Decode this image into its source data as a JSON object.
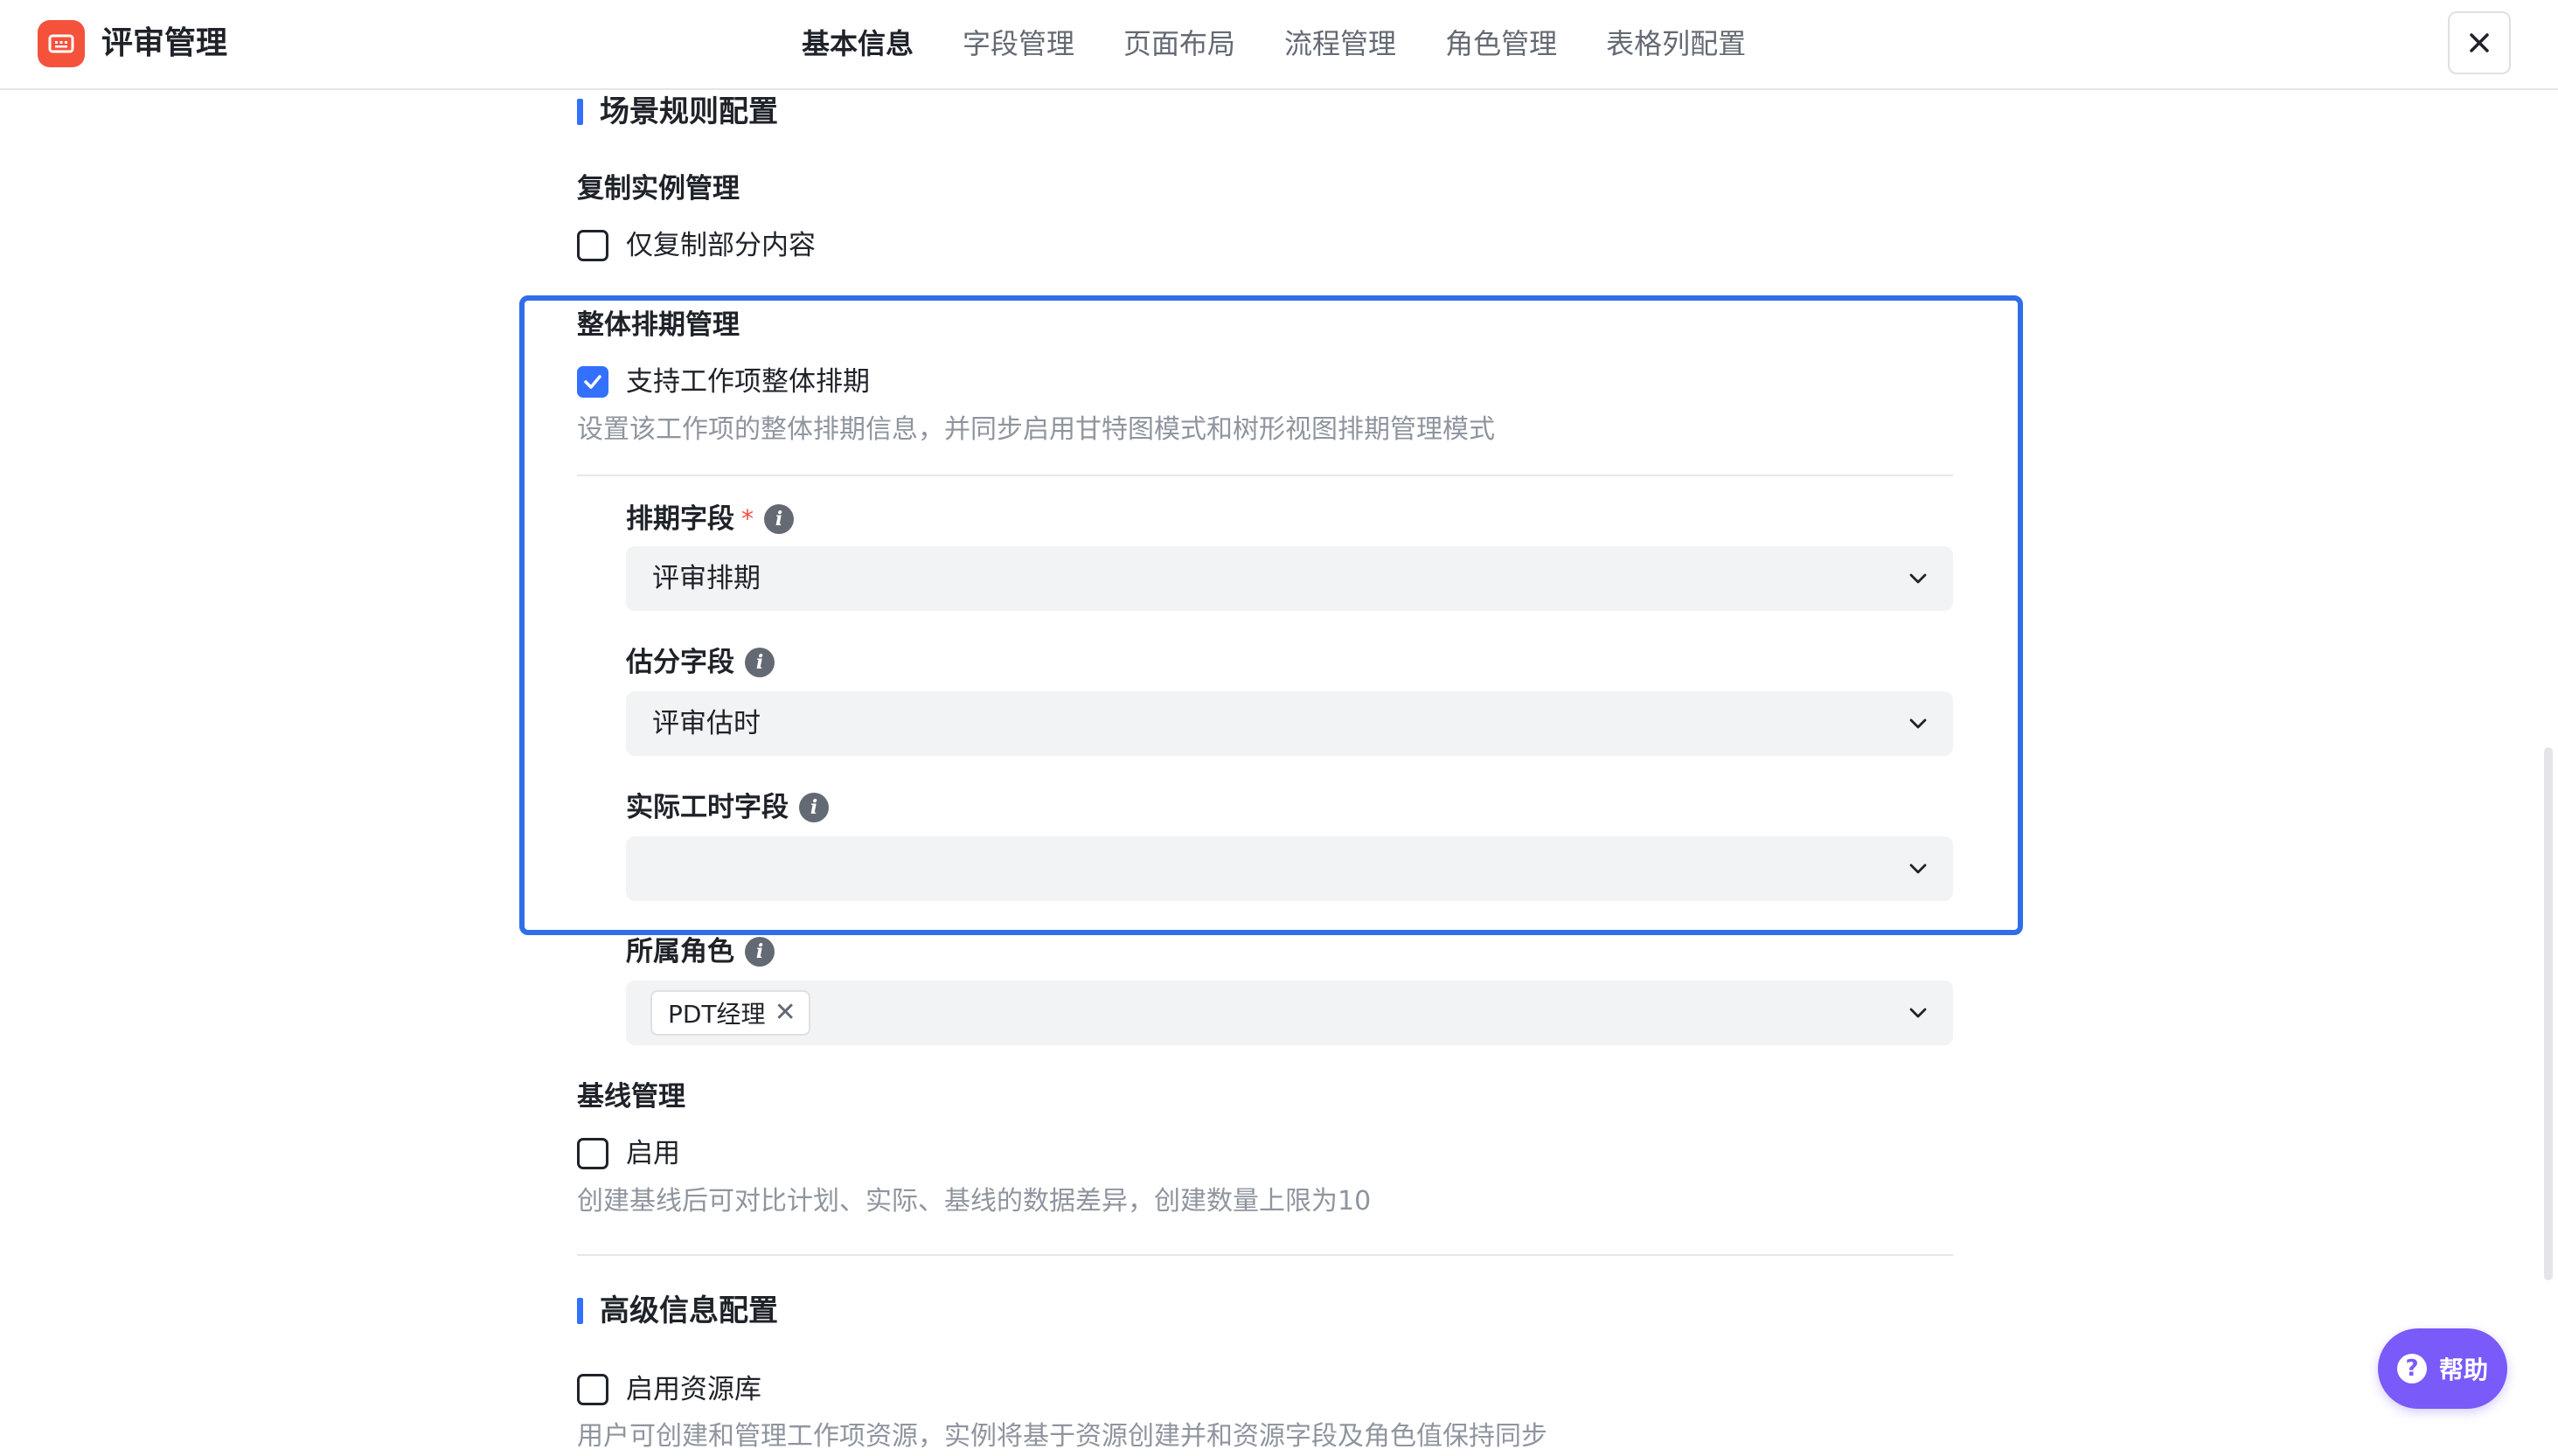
{
  "header": {
    "title": "评审管理",
    "tabs": [
      {
        "label": "基本信息",
        "active": true
      },
      {
        "label": "字段管理",
        "active": false
      },
      {
        "label": "页面布局",
        "active": false
      },
      {
        "label": "流程管理",
        "active": false
      },
      {
        "label": "角色管理",
        "active": false
      },
      {
        "label": "表格列配置",
        "active": false
      }
    ]
  },
  "scene_rules": {
    "title": "场景规则配置",
    "copy_instance": {
      "label": "复制实例管理",
      "option_label": "仅复制部分内容",
      "checked": false
    },
    "overall_schedule": {
      "label": "整体排期管理",
      "option_label": "支持工作项整体排期",
      "checked": true,
      "description": "设置该工作项的整体排期信息，并同步启用甘特图模式和树形视图排期管理模式",
      "schedule_field": {
        "label": "排期字段",
        "required_mark": "*",
        "value": "评审排期"
      },
      "estimate_field": {
        "label": "估分字段",
        "value": "评审估时"
      },
      "actual_hours_field": {
        "label": "实际工时字段",
        "value": ""
      },
      "roles_field": {
        "label": "所属角色",
        "tags": [
          "PDT经理"
        ]
      }
    },
    "baseline": {
      "label": "基线管理",
      "option_label": "启用",
      "checked": false,
      "description": "创建基线后可对比计划、实际、基线的数据差异，创建数量上限为10"
    }
  },
  "advanced": {
    "title": "高级信息配置",
    "resource_lib": {
      "option_label": "启用资源库",
      "checked": false,
      "description": "用户可创建和管理工作项资源，实例将基于资源创建并和资源字段及角色值保持同步"
    }
  },
  "help": {
    "label": "帮助"
  },
  "colors": {
    "accent": "#3370ff",
    "highlight": "#2f6ee8",
    "logo": "#f5523c",
    "help": "#7a5af8"
  }
}
